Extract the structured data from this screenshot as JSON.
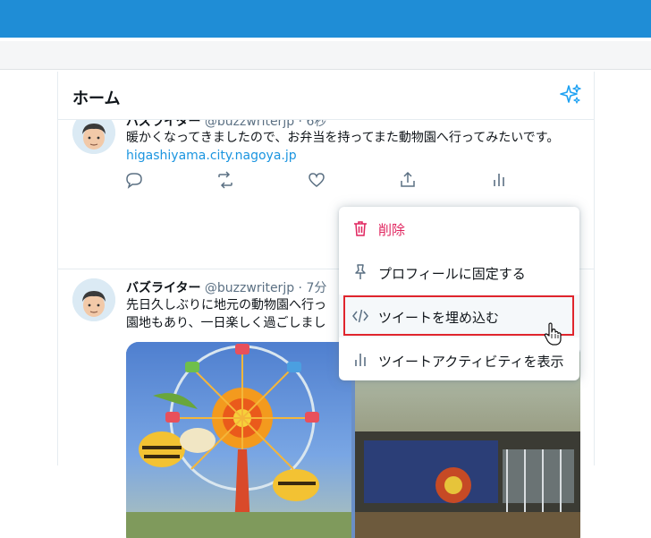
{
  "header": {
    "title": "ホーム"
  },
  "tweets": [
    {
      "name": "バズライター",
      "handle": "@buzzwriterjp",
      "time": "6秒",
      "text": "暖かくなってきましたので、お弁当を持ってまた動物園へ行ってみたいです。",
      "link": "higashiyama.city.nagoya.jp"
    },
    {
      "name": "バズライター",
      "handle": "@buzzwriterjp",
      "time": "7分",
      "text_line1": "先日久しぶりに地元の動物園へ行っ",
      "text_line2": "園地もあり、一日楽しく過ごしまし"
    }
  ],
  "menu": {
    "items": [
      {
        "label": "削除",
        "icon": "trash-icon",
        "danger": true
      },
      {
        "label": "プロフィールに固定する",
        "icon": "pin-icon"
      },
      {
        "label": "ツイートを埋め込む",
        "icon": "code-icon"
      },
      {
        "label": "ツイートアクティビティを表示",
        "icon": "bar-chart-icon"
      }
    ]
  },
  "colors": {
    "topbar": "#1f8dd6",
    "accent": "#1da1f2",
    "danger": "#e0245e",
    "highlight_border": "#e0252d"
  }
}
